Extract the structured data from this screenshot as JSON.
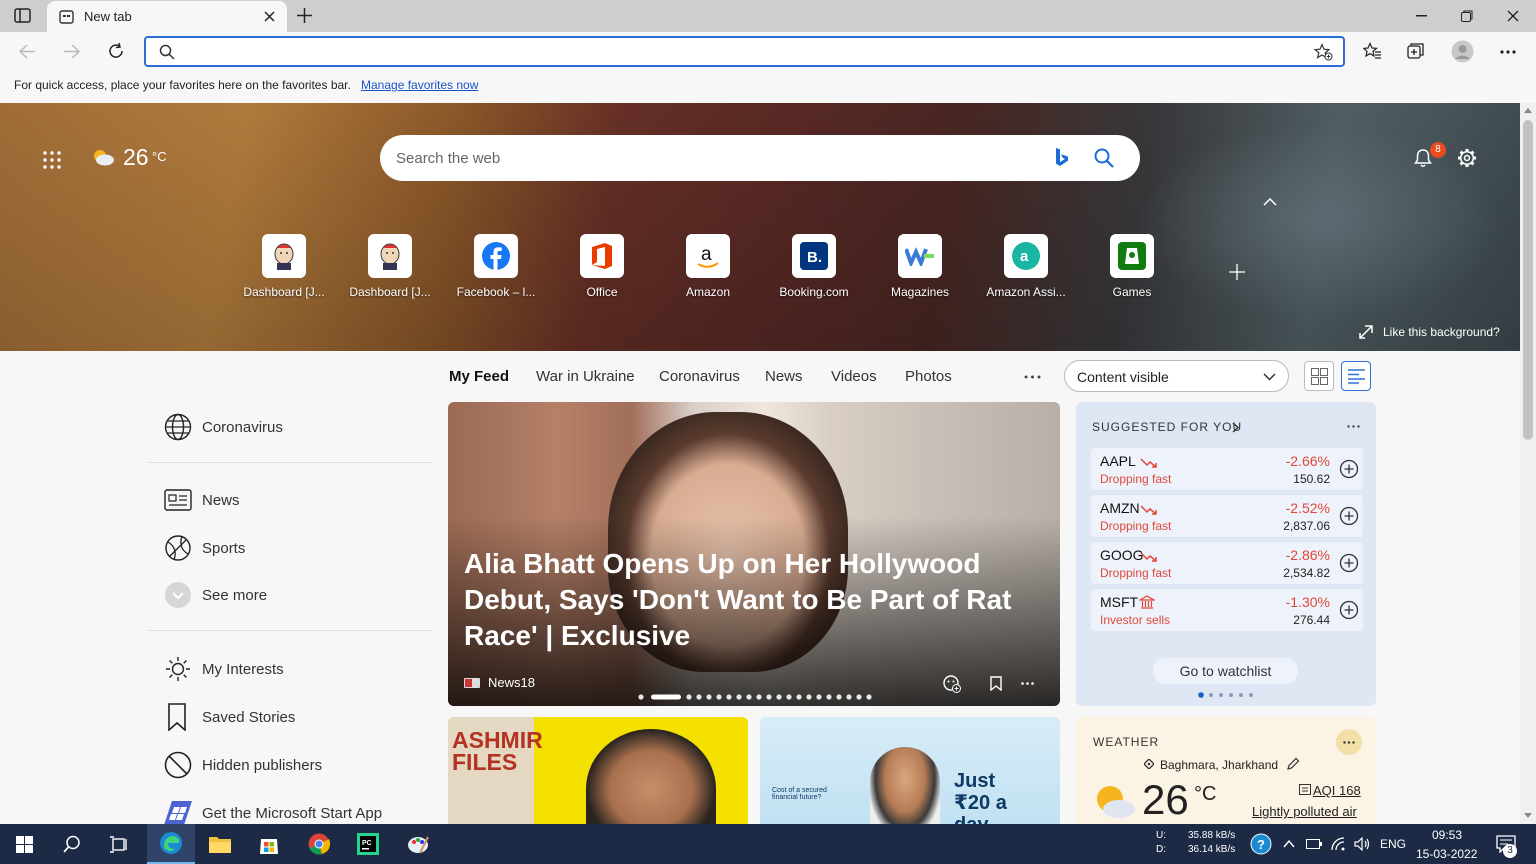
{
  "browser": {
    "tab_title": "New tab",
    "address_value": "",
    "favorites_hint": "For quick access, place your favorites here on the favorites bar.",
    "favorites_link": "Manage favorites now"
  },
  "hero": {
    "weather_temp": "26",
    "weather_unit": "°C",
    "search_placeholder": "Search the web",
    "notification_count": "8",
    "like_background": "Like this background?",
    "tiles": [
      {
        "label": "Dashboard [J...",
        "icon": "jenkins-icon"
      },
      {
        "label": "Dashboard [J...",
        "icon": "jenkins-icon"
      },
      {
        "label": "Facebook – l...",
        "icon": "facebook-icon"
      },
      {
        "label": "Office",
        "icon": "office-icon"
      },
      {
        "label": "Amazon",
        "icon": "amazon-icon"
      },
      {
        "label": "Booking.com",
        "icon": "booking-icon"
      },
      {
        "label": "Magazines",
        "icon": "magazines-icon"
      },
      {
        "label": "Amazon Assi...",
        "icon": "amazon-assistant-icon"
      },
      {
        "label": "Games",
        "icon": "games-icon"
      }
    ]
  },
  "feed": {
    "tabs": [
      "My Feed",
      "War in Ukraine",
      "Coronavirus",
      "News",
      "Videos",
      "Photos"
    ],
    "content_select": "Content visible",
    "sidebar": [
      {
        "label": "Coronavirus",
        "icon": "globe-icon"
      },
      {
        "label": "News",
        "icon": "newspaper-icon"
      },
      {
        "label": "Sports",
        "icon": "sports-ball-icon"
      },
      {
        "label": "See more",
        "icon": "chevron-down-icon"
      },
      {
        "label": "My Interests",
        "icon": "sun-icon"
      },
      {
        "label": "Saved Stories",
        "icon": "bookmark-icon"
      },
      {
        "label": "Hidden publishers",
        "icon": "block-icon"
      },
      {
        "label": "Get the Microsoft Start App",
        "icon": "microsoft-start-icon"
      }
    ],
    "main_story": {
      "headline": "Alia Bhatt Opens Up on Her Hollywood Debut, Says 'Don't Want to Be Part of Rat Race' | Exclusive",
      "source": "News18"
    },
    "card2_text": "ASHMIR FILES",
    "card3_text_a": "Cost of a secured financial future?",
    "card3_text_b": "Just ₹20 a day"
  },
  "stocks": {
    "title": "SUGGESTED FOR YOU",
    "items": [
      {
        "symbol": "AAPL",
        "note": "Dropping fast",
        "change": "-2.66%",
        "price": "150.62"
      },
      {
        "symbol": "AMZN",
        "note": "Dropping fast",
        "change": "-2.52%",
        "price": "2,837.06"
      },
      {
        "symbol": "GOOG",
        "note": "Dropping fast",
        "change": "-2.86%",
        "price": "2,534.82"
      },
      {
        "symbol": "MSFT",
        "note": "Investor sells",
        "change": "-1.30%",
        "price": "276.44"
      }
    ],
    "watchlist_button": "Go to watchlist",
    "pager_dots": 6,
    "pager_active": 0
  },
  "weather": {
    "title": "WEATHER",
    "location": "Baghmara, Jharkhand",
    "temp": "26",
    "unit": "°C",
    "aqi": "AQI 168",
    "aqi_desc": "Lightly polluted air"
  },
  "taskbar": {
    "net_up_label": "U:",
    "net_up": "35.88 kB/s",
    "net_down_label": "D:",
    "net_down": "36.14 kB/s",
    "lang": "ENG",
    "time": "09:53",
    "date": "15-03-2022",
    "notif_count": "3"
  },
  "colors": {
    "accent": "#2b6fd6",
    "negative": "#e0483a",
    "taskbar": "#1c2a45"
  }
}
